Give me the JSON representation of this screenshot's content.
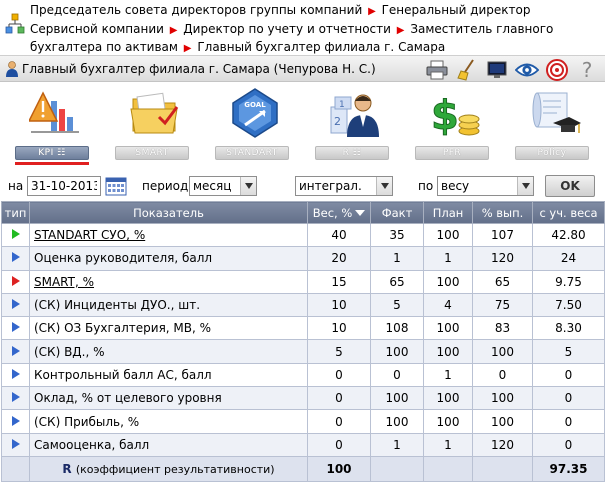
{
  "breadcrumb": {
    "items": [
      "Председатель совета директоров группы компаний",
      "Генеральный директор Сервисной компании",
      "Директор по учету и отчетности",
      "Заместитель главного бухгалтера по активам",
      "Главный бухгалтер филиала г. Самара"
    ]
  },
  "user": {
    "label": "Главный бухгалтер филиала г. Самара   (Чепурова Н. С.)"
  },
  "nav": {
    "items": [
      {
        "label": "KPI ☷",
        "icon": "warning-chart-icon"
      },
      {
        "label": "SMART",
        "icon": "folder-icon"
      },
      {
        "label": "STANDART",
        "icon": "goal-icon"
      },
      {
        "label": "R ☷",
        "icon": "person-icon"
      },
      {
        "label": "PFR",
        "icon": "money-icon"
      },
      {
        "label": "Policy",
        "icon": "scroll-graduation-icon"
      }
    ]
  },
  "filters": {
    "on_label": "на",
    "date": "31-10-2013",
    "period_label": "период",
    "period": "месяц",
    "mode": "интеграл.",
    "by_label": "по",
    "by": "весу",
    "ok": "OK"
  },
  "table": {
    "columns": [
      "тип",
      "Показатель",
      "Вес, %",
      "Факт",
      "План",
      "% вып.",
      "с уч. веса"
    ],
    "rows": [
      {
        "type": "green",
        "name": "STANDART СУО, %",
        "link": true,
        "weight": "40",
        "fact": "35",
        "plan": "100",
        "pct": "107",
        "weighted": "42.80"
      },
      {
        "type": "blue",
        "name": "Оценка руководителя, балл",
        "link": false,
        "weight": "20",
        "fact": "1",
        "plan": "1",
        "pct": "120",
        "weighted": "24"
      },
      {
        "type": "red",
        "name": "SMART, %",
        "link": true,
        "weight": "15",
        "fact": "65",
        "plan": "100",
        "pct": "65",
        "weighted": "9.75"
      },
      {
        "type": "blue",
        "name": "(СК) Инциденты ДУО., шт.",
        "link": false,
        "weight": "10",
        "fact": "5",
        "plan": "4",
        "pct": "75",
        "weighted": "7.50"
      },
      {
        "type": "blue",
        "name": "(СК) ОЗ Бухгалтерия, МВ, %",
        "link": false,
        "weight": "10",
        "fact": "108",
        "plan": "100",
        "pct": "83",
        "weighted": "8.30"
      },
      {
        "type": "blue",
        "name": "(СК) ВД., %",
        "link": false,
        "weight": "5",
        "fact": "100",
        "plan": "100",
        "pct": "100",
        "weighted": "5"
      },
      {
        "type": "blue",
        "name": "Контрольный балл АС, балл",
        "link": false,
        "weight": "0",
        "fact": "0",
        "plan": "1",
        "pct": "0",
        "weighted": "0"
      },
      {
        "type": "blue",
        "name": "Оклад, % от целевого уровня",
        "link": false,
        "weight": "0",
        "fact": "100",
        "plan": "100",
        "pct": "100",
        "weighted": "0"
      },
      {
        "type": "blue",
        "name": "(СК) Прибыль, %",
        "link": false,
        "weight": "0",
        "fact": "100",
        "plan": "100",
        "pct": "100",
        "weighted": "0"
      },
      {
        "type": "blue",
        "name": "Самооценка, балл",
        "link": false,
        "weight": "0",
        "fact": "1",
        "plan": "1",
        "pct": "120",
        "weighted": "0"
      }
    ],
    "footer": {
      "r_label": "R",
      "coef_label": "(коэффициент результативности)",
      "weight_total": "100",
      "weighted_total": "97.35"
    }
  },
  "colors": {
    "header_bg": "#6e7a94",
    "accent_red": "#e00000",
    "type_green": "#22bb22",
    "type_blue": "#3366cc",
    "type_red": "#dd2222"
  }
}
